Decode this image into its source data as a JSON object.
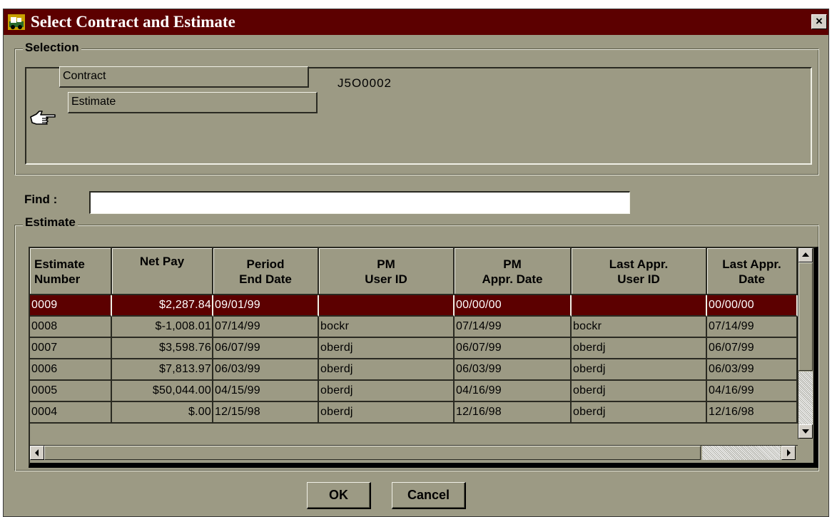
{
  "window": {
    "title": "Select Contract and Estimate",
    "close_label": "×"
  },
  "selection": {
    "legend": "Selection",
    "contract_label": "Contract",
    "contract_value": "J5O0002",
    "estimate_label": "Estimate"
  },
  "find": {
    "label": "Find :",
    "value": "",
    "placeholder": ""
  },
  "estimate_group": {
    "legend": "Estimate",
    "columns": [
      "Estimate\nNumber",
      "Net Pay",
      "Period\nEnd Date",
      "PM\nUser ID",
      "PM\nAppr. Date",
      "Last Appr.\nUser ID",
      "Last Appr.\nDate"
    ],
    "rows": [
      [
        "0009",
        "$2,287.84",
        "09/01/99",
        "",
        "00/00/00",
        "",
        "00/00/00"
      ],
      [
        "0008",
        "$-1,008.01",
        "07/14/99",
        "bockr",
        "07/14/99",
        "bockr",
        "07/14/99"
      ],
      [
        "0007",
        "$3,598.76",
        "06/07/99",
        "oberdj",
        "06/07/99",
        "oberdj",
        "06/07/99"
      ],
      [
        "0006",
        "$7,813.97",
        "06/03/99",
        "oberdj",
        "06/03/99",
        "oberdj",
        "06/03/99"
      ],
      [
        "0005",
        "$50,044.00",
        "04/15/99",
        "oberdj",
        "04/16/99",
        "oberdj",
        "04/16/99"
      ],
      [
        "0004",
        "$.00",
        "12/15/98",
        "oberdj",
        "12/16/98",
        "oberdj",
        "12/16/98"
      ]
    ],
    "selected_row": 0
  },
  "buttons": {
    "ok_label": "OK",
    "cancel_label": "Cancel"
  },
  "colors": {
    "title_bar": "#5c0000",
    "window_bg": "#9c9a84",
    "selected_row": "#5c0000"
  },
  "icons": [
    "app-icon",
    "pointing-hand-icon",
    "close-icon",
    "scroll-up-icon",
    "scroll-down-icon",
    "scroll-left-icon",
    "scroll-right-icon"
  ]
}
